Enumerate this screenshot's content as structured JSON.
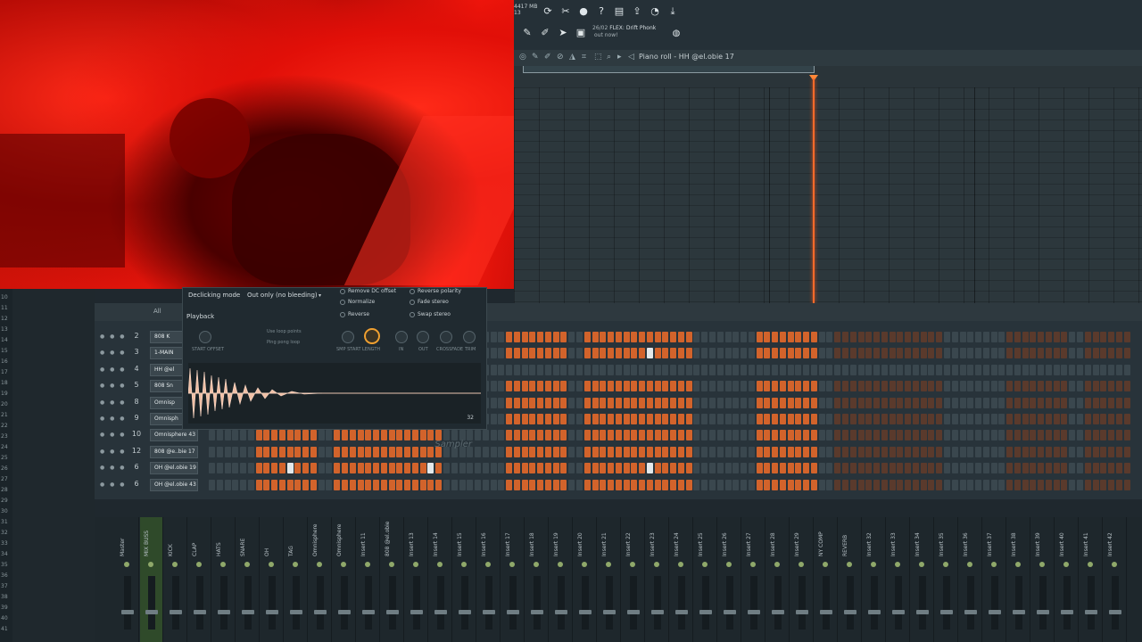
{
  "toolbar": {
    "memory": "4417 MB",
    "cpu": "13",
    "hint_counter": "26/02",
    "hint_title": "FLEX: Drift Phonk",
    "hint_sub": "out now!",
    "icons": [
      "reload-icon",
      "cut-icon",
      "mic-icon",
      "help-icon",
      "browser-icon",
      "chat-icon",
      "save-icon",
      "export-icon",
      "download-icon"
    ],
    "tools": [
      "pencil-icon",
      "brush-icon",
      "paint-icon",
      "stamp-icon"
    ]
  },
  "piano_roll": {
    "title": "Piano roll - HH @el.obie 17",
    "tools": [
      "magnet-icon",
      "pencil-icon",
      "brush-icon",
      "delete-icon",
      "mute-icon",
      "slice-icon",
      "select-icon",
      "zoom-icon",
      "playback-icon",
      "speaker-icon"
    ]
  },
  "channel_rack": {
    "filter": "All",
    "channels": [
      {
        "num": "2",
        "name": "808 K"
      },
      {
        "num": "3",
        "name": "1-MAIN"
      },
      {
        "num": "4",
        "name": "HH @el"
      },
      {
        "num": "5",
        "name": "808 Sn"
      },
      {
        "num": "8",
        "name": "Omnisp"
      },
      {
        "num": "9",
        "name": "Omnisph"
      },
      {
        "num": "10",
        "name": "Omnisphere 43"
      },
      {
        "num": "12",
        "name": "808 @e..bie 17"
      },
      {
        "num": "6",
        "name": "OH @el.obie 19"
      },
      {
        "num": "6",
        "name": "OH @el.obie 43"
      }
    ]
  },
  "sampler": {
    "declicking_label": "Declicking mode",
    "declicking_value": "Out only (no bleeding)",
    "playback_label": "Playback",
    "use_loop_points": "Use loop points",
    "ping_pong_loop": "Ping pong loop",
    "remove_dc": "Remove DC offset",
    "normalize": "Normalize",
    "reverse": "Reverse",
    "reverse_polarity": "Reverse polarity",
    "fade_stereo": "Fade stereo",
    "swap_stereo": "Swap stereo",
    "start_offset": "START OFFSET",
    "smp_start": "SMP START",
    "length": "LENGTH",
    "in": "IN",
    "out": "OUT",
    "crossfade": "CROSSFADE",
    "trim": "TRIM",
    "title": "Sampler",
    "bits": "32"
  },
  "mixer": {
    "strips": [
      "Master",
      "MIX BUSS",
      "KICK",
      "CLAP",
      "HATS",
      "SNARE",
      "OH",
      "TAG",
      "Omnisphere",
      "Omnisphere",
      "Insert 11",
      "808 @el.obie",
      "Insert 13",
      "Insert 14",
      "Insert 15",
      "Insert 16",
      "Insert 17",
      "Insert 18",
      "Insert 19",
      "Insert 20",
      "Insert 21",
      "Insert 22",
      "Insert 23",
      "Insert 24",
      "Insert 25",
      "Insert 26",
      "Insert 27",
      "Insert 28",
      "Insert 29",
      "NY COMP",
      "REVERB",
      "Insert 32",
      "Insert 33",
      "Insert 34",
      "Insert 35",
      "Insert 36",
      "Insert 37",
      "Insert 38",
      "Insert 39",
      "Insert 40",
      "Insert 41",
      "Insert 42"
    ]
  },
  "left_numbers": [
    "10",
    "11",
    "12",
    "13",
    "14",
    "15",
    "16",
    "17",
    "18",
    "19",
    "20",
    "21",
    "22",
    "23",
    "24",
    "25",
    "26",
    "27",
    "28",
    "29",
    "30",
    "31",
    "32",
    "33",
    "34",
    "35",
    "36",
    "37",
    "38",
    "39",
    "40",
    "41"
  ]
}
